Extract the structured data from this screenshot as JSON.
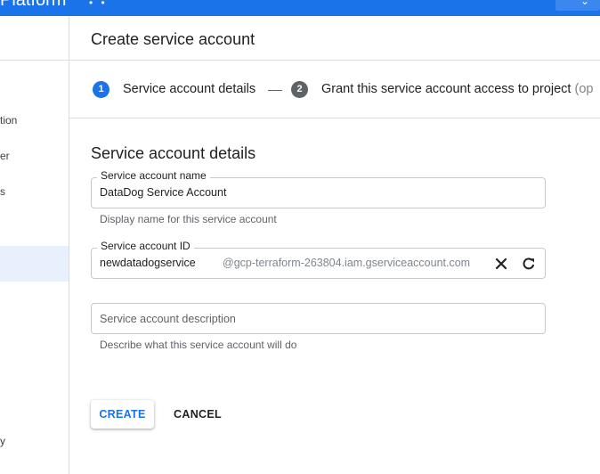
{
  "topbar": {
    "brand": "Platform",
    "color": "#1a73e8"
  },
  "sidebar": {
    "items": [
      {
        "label": "tion"
      },
      {
        "label": "er"
      },
      {
        "label": "s"
      },
      {
        "label": "y"
      }
    ],
    "active_color": "#e8f0fe"
  },
  "header": {
    "title": "Create service account"
  },
  "stepper": {
    "steps": [
      {
        "number": "1",
        "label": "Service account details",
        "active": true,
        "color": "#1a73e8"
      },
      {
        "number": "2",
        "label": "Grant this service account access to project",
        "suffix": "(op",
        "active": false,
        "color": "#5f6368"
      }
    ]
  },
  "form": {
    "section_title": "Service account details",
    "name": {
      "label": "Service account name",
      "value": "DataDog Service Account",
      "helper": "Display name for this service account"
    },
    "account_id": {
      "label": "Service account ID",
      "value": "newdatadogserviceacco",
      "suffix": "@gcp-terraform-263804.iam.gserviceaccount.com",
      "clear_icon": "close-icon",
      "regenerate_icon": "refresh-icon"
    },
    "description": {
      "placeholder": "Service account description",
      "helper": "Describe what this service account will do"
    }
  },
  "actions": {
    "create_label": "CREATE",
    "cancel_label": "CANCEL"
  }
}
